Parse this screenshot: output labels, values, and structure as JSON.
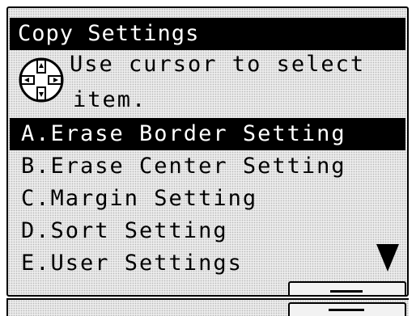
{
  "screen": {
    "title": "Copy Settings",
    "hint_line1": "Use cursor to select",
    "hint_line2": "item.",
    "hint_icon": "cursor-key-icon",
    "menu": {
      "selected_index": 0,
      "items": [
        {
          "label": "A.Erase Border Setting"
        },
        {
          "label": "B.Erase Center Setting"
        },
        {
          "label": "C.Margin Setting"
        },
        {
          "label": "D.Sort Setting"
        },
        {
          "label": "E.User Settings"
        }
      ]
    },
    "scroll_icon": "scroll-down-arrow-icon",
    "softkeys": {
      "upper_icon": "softkey-dash-icon",
      "lower_icon": "softkey-dash-icon"
    },
    "colors": {
      "highlight": "#000000",
      "lcd_background": "#ececec"
    }
  }
}
